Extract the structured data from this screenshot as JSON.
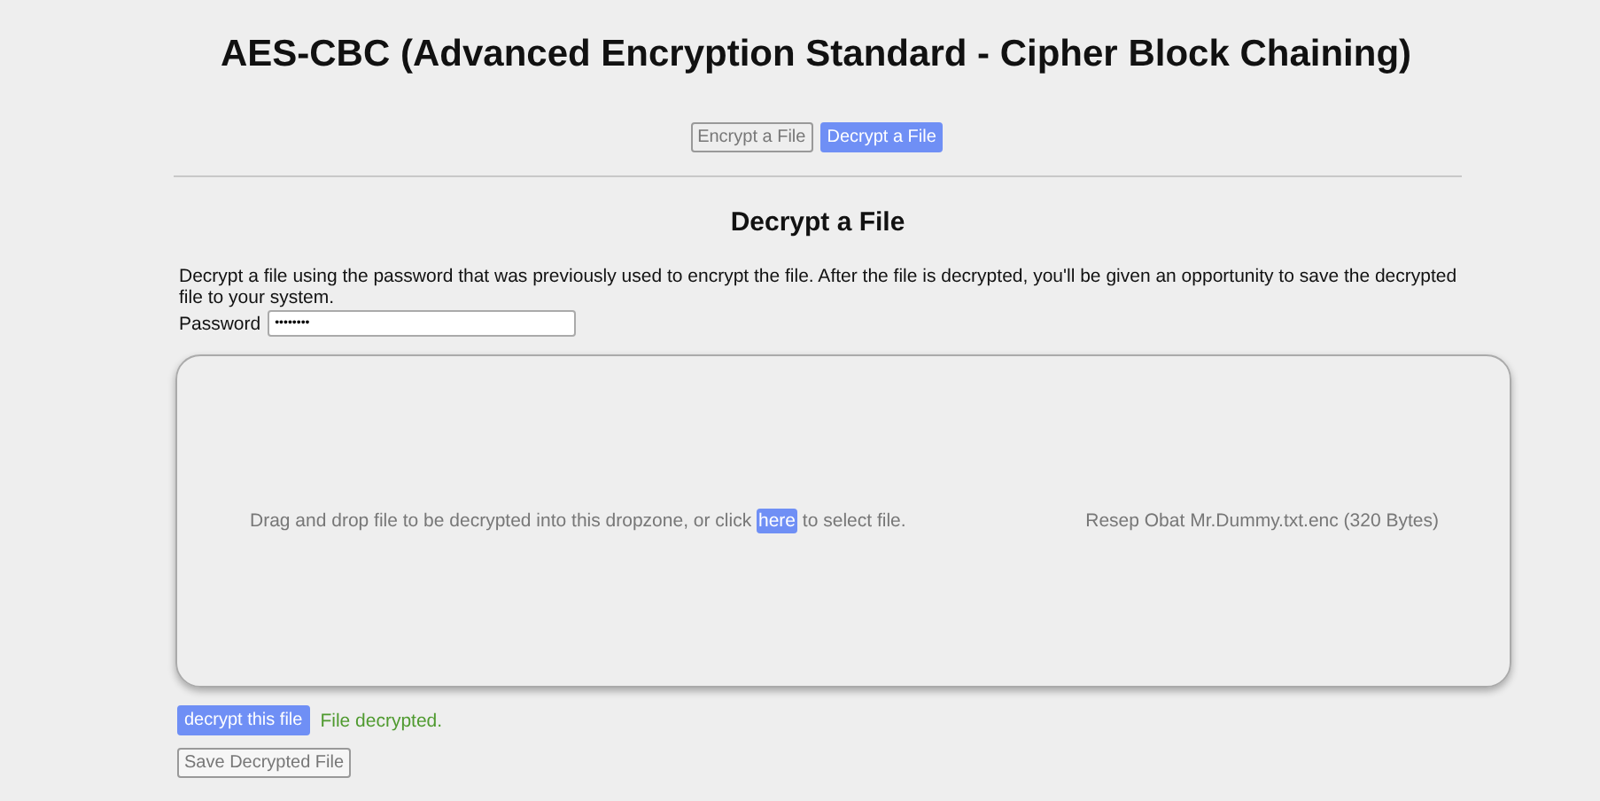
{
  "title": "AES-CBC (Advanced Encryption Standard - Cipher Block Chaining)",
  "tabs": [
    {
      "label": "Encrypt a File",
      "selected": false
    },
    {
      "label": "Decrypt a File",
      "selected": true
    }
  ],
  "heading": "Decrypt a File",
  "description": "Decrypt a file using the password that was previously used to encrypt the file. After the file is decrypted, you'll be given an opportunity to save the decrypted file to your system.",
  "password": {
    "label": "Password",
    "value": "••••••••"
  },
  "dropzone": {
    "before": "Drag and drop file to be decrypted into this dropzone, or click",
    "link": "here",
    "after": "to select file.",
    "file": "Resep Obat Mr.Dummy.txt.enc (320 Bytes)"
  },
  "decrypt_button": "decrypt this file",
  "status": "File decrypted.",
  "save_button": {
    "label": "Save Decrypted File",
    "disabled": true
  }
}
